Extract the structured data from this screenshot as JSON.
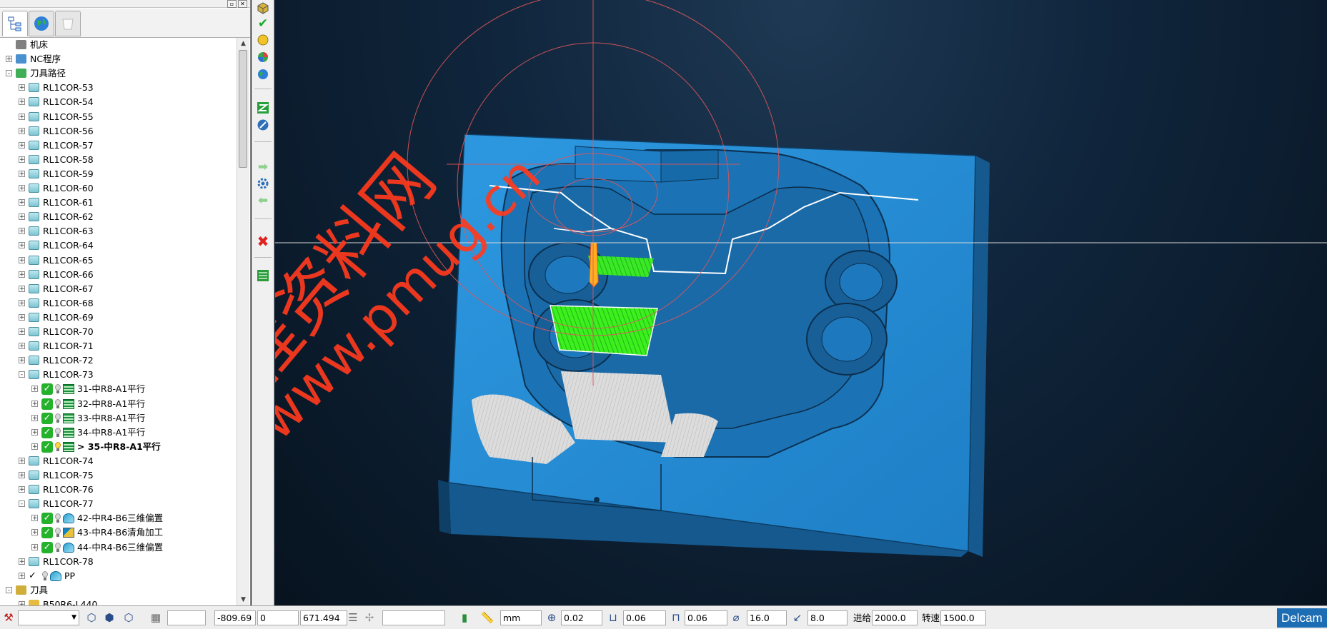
{
  "explorer": {
    "tabs": [
      {
        "name": "tree-tab",
        "icon": "tree-structure-icon",
        "active": true
      },
      {
        "name": "globe-tab",
        "icon": "globe-icon",
        "active": false
      },
      {
        "name": "blank-tab",
        "icon": "cup-icon",
        "active": false
      }
    ],
    "tree": [
      {
        "label": "机床",
        "level": 0,
        "expander": "",
        "icon": "machine-icon",
        "bold": false
      },
      {
        "label": "NC程序",
        "level": 0,
        "expander": "+",
        "icon": "nc-program-icon",
        "bold": false
      },
      {
        "label": "刀具路径",
        "level": 0,
        "expander": "-",
        "icon": "toolpath-icon",
        "bold": false
      },
      {
        "label": "RL1COR-53",
        "level": 1,
        "expander": "+",
        "icon": "folder-icon"
      },
      {
        "label": "RL1COR-54",
        "level": 1,
        "expander": "+",
        "icon": "folder-icon"
      },
      {
        "label": "RL1COR-55",
        "level": 1,
        "expander": "+",
        "icon": "folder-icon"
      },
      {
        "label": "RL1COR-56",
        "level": 1,
        "expander": "+",
        "icon": "folder-icon"
      },
      {
        "label": "RL1COR-57",
        "level": 1,
        "expander": "+",
        "icon": "folder-icon"
      },
      {
        "label": "RL1COR-58",
        "level": 1,
        "expander": "+",
        "icon": "folder-icon"
      },
      {
        "label": "RL1COR-59",
        "level": 1,
        "expander": "+",
        "icon": "folder-icon"
      },
      {
        "label": "RL1COR-60",
        "level": 1,
        "expander": "+",
        "icon": "folder-icon"
      },
      {
        "label": "RL1COR-61",
        "level": 1,
        "expander": "+",
        "icon": "folder-icon"
      },
      {
        "label": "RL1COR-62",
        "level": 1,
        "expander": "+",
        "icon": "folder-icon"
      },
      {
        "label": "RL1COR-63",
        "level": 1,
        "expander": "+",
        "icon": "folder-icon"
      },
      {
        "label": "RL1COR-64",
        "level": 1,
        "expander": "+",
        "icon": "folder-icon"
      },
      {
        "label": "RL1COR-65",
        "level": 1,
        "expander": "+",
        "icon": "folder-icon"
      },
      {
        "label": "RL1COR-66",
        "level": 1,
        "expander": "+",
        "icon": "folder-icon"
      },
      {
        "label": "RL1COR-67",
        "level": 1,
        "expander": "+",
        "icon": "folder-icon"
      },
      {
        "label": "RL1COR-68",
        "level": 1,
        "expander": "+",
        "icon": "folder-icon"
      },
      {
        "label": "RL1COR-69",
        "level": 1,
        "expander": "+",
        "icon": "folder-icon"
      },
      {
        "label": "RL1COR-70",
        "level": 1,
        "expander": "+",
        "icon": "folder-icon"
      },
      {
        "label": "RL1COR-71",
        "level": 1,
        "expander": "+",
        "icon": "folder-icon"
      },
      {
        "label": "RL1COR-72",
        "level": 1,
        "expander": "+",
        "icon": "folder-icon"
      },
      {
        "label": "RL1COR-73",
        "level": 1,
        "expander": "-",
        "icon": "folder-icon"
      },
      {
        "label": "31-中R8-A1平行",
        "level": 2,
        "expander": "+",
        "icon": "toolpath-raster-icon",
        "bulb": "off",
        "check": true
      },
      {
        "label": "32-中R8-A1平行",
        "level": 2,
        "expander": "+",
        "icon": "toolpath-raster-icon",
        "bulb": "off",
        "check": true
      },
      {
        "label": "33-中R8-A1平行",
        "level": 2,
        "expander": "+",
        "icon": "toolpath-raster-icon",
        "bulb": "off",
        "check": true
      },
      {
        "label": "34-中R8-A1平行",
        "level": 2,
        "expander": "+",
        "icon": "toolpath-raster-icon",
        "bulb": "off",
        "check": true
      },
      {
        "label": "> 35-中R8-A1平行",
        "level": 2,
        "expander": "+",
        "icon": "toolpath-raster-icon",
        "bulb": "on",
        "check": true,
        "bold": true
      },
      {
        "label": "RL1COR-74",
        "level": 1,
        "expander": "+",
        "icon": "folder-icon"
      },
      {
        "label": "RL1COR-75",
        "level": 1,
        "expander": "+",
        "icon": "folder-icon"
      },
      {
        "label": "RL1COR-76",
        "level": 1,
        "expander": "+",
        "icon": "folder-icon"
      },
      {
        "label": "RL1COR-77",
        "level": 1,
        "expander": "-",
        "icon": "folder-icon"
      },
      {
        "label": "42-中R4-B6三维偏置",
        "level": 2,
        "expander": "+",
        "icon": "toolpath-offset-icon",
        "bulb": "off",
        "check": true
      },
      {
        "label": "43-中R4-B6清角加工",
        "level": 2,
        "expander": "+",
        "icon": "toolpath-corner-icon",
        "bulb": "off",
        "check": true
      },
      {
        "label": "44-中R4-B6三维偏置",
        "level": 2,
        "expander": "+",
        "icon": "toolpath-offset-icon",
        "bulb": "off",
        "check": true
      },
      {
        "label": "RL1COR-78",
        "level": 1,
        "expander": "+",
        "icon": "folder-icon"
      },
      {
        "label": "PP",
        "level": 1,
        "expander": "+",
        "icon": "toolpath-pp-icon",
        "bulb": "off",
        "check": false,
        "tick": true
      },
      {
        "label": "刀具",
        "level": 0,
        "expander": "-",
        "icon": "tool-icon",
        "bold": false
      },
      {
        "label": "B50R6-L440",
        "level": 1,
        "expander": "+",
        "icon": "tool-item-icon",
        "partial": true
      }
    ]
  },
  "vertical_toolbar": [
    {
      "name": "stock-icon"
    },
    {
      "name": "accept-check-icon"
    },
    {
      "name": "yellow-sphere-icon"
    },
    {
      "name": "shading-ball-icon"
    },
    {
      "name": "globe-view-icon"
    },
    {
      "name": "toolpath-link-icon"
    },
    {
      "name": "edit-path-icon"
    },
    {
      "name": "next-arrow-icon"
    },
    {
      "name": "settings-gear-icon"
    },
    {
      "name": "prev-arrow-icon"
    },
    {
      "name": "delete-x-icon"
    },
    {
      "name": "green-list-icon"
    }
  ],
  "watermark": {
    "line1": "编程资料网",
    "line2": "www.pmug.cn",
    "color": "#ff3a1e"
  },
  "statusbar": {
    "selector_value": "",
    "grid_value": "",
    "x": "-809.69",
    "y": "0",
    "z": "671.494",
    "empty_field": "",
    "units": "mm",
    "tolerance": "0.02",
    "thickness": "0.06",
    "axial_thickness": "0.06",
    "diameter": "16.0",
    "stepover": "8.0",
    "feed_label": "进给",
    "feed": "2000.0",
    "speed_label": "转速",
    "speed": "1500.0",
    "brand": "Delcam"
  },
  "colors": {
    "part_blue": "#2a8fd6",
    "part_dark": "#13507e",
    "toolpath_green": "#3cf01e",
    "stock_gray": "#d8d8d8",
    "tool_orange": "#ffb020",
    "wire_red": "#e0565a"
  }
}
